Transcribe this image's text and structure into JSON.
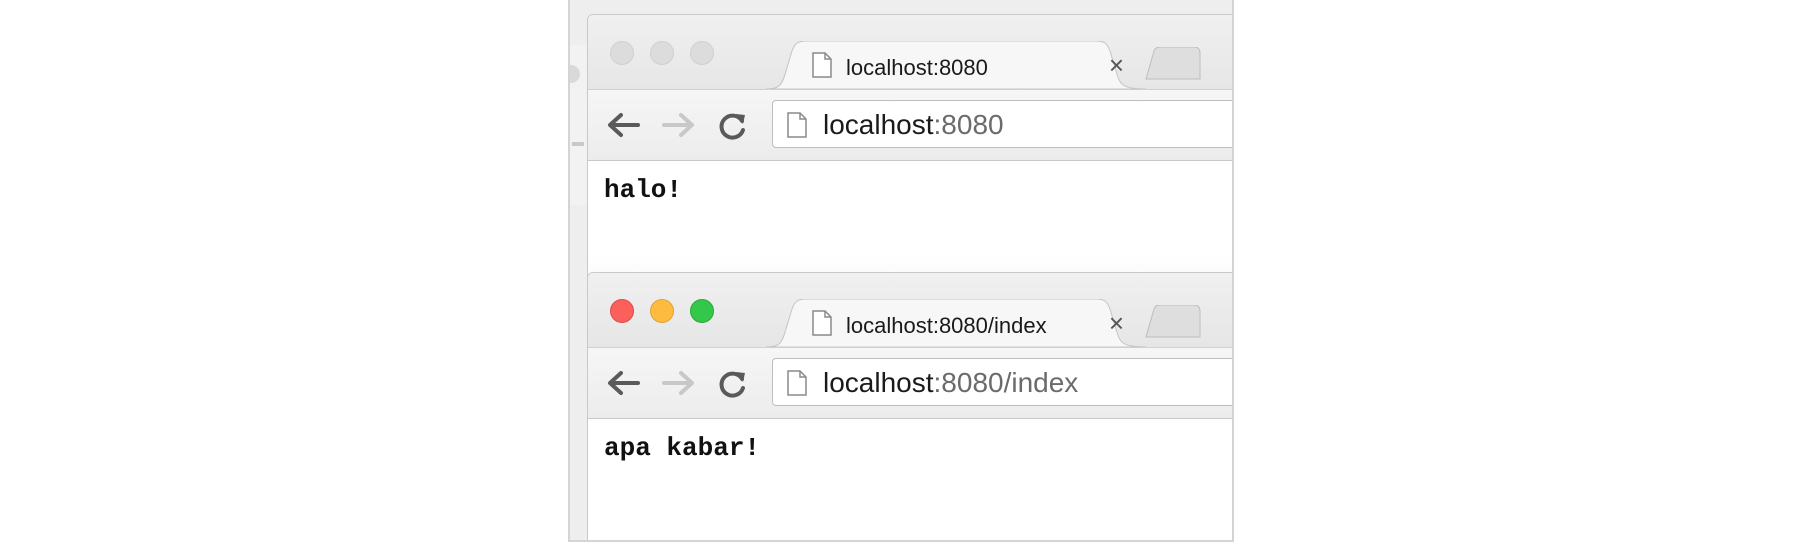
{
  "windows": [
    {
      "state": "inactive",
      "tab": {
        "title": "localhost:8080",
        "close": "×"
      },
      "omnibox": {
        "host": "localhost",
        "path": ":8080"
      },
      "page_text": "halo!"
    },
    {
      "state": "active",
      "tab": {
        "title": "localhost:8080/index",
        "close": "×"
      },
      "omnibox": {
        "host": "localhost",
        "path": ":8080/index"
      },
      "page_text": "apa kabar!"
    }
  ],
  "icons": {
    "back": "arrow-left-icon",
    "forward": "arrow-right-icon",
    "reload": "reload-icon",
    "page": "document-icon"
  },
  "colors": {
    "traffic_red": "#fc605c",
    "traffic_yellow": "#fdbc40",
    "traffic_green": "#34c84a",
    "url_path": "#6b6b6b"
  }
}
